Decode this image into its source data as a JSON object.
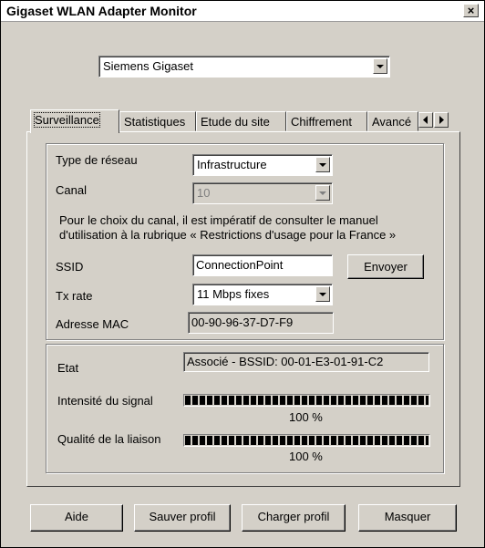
{
  "window": {
    "title": "Gigaset WLAN Adapter Monitor",
    "close_glyph": "×"
  },
  "adapter": {
    "selected": "Siemens Gigaset"
  },
  "tabs": [
    {
      "label": "Surveillance"
    },
    {
      "label": "Statistiques"
    },
    {
      "label": "Etude du site"
    },
    {
      "label": "Chiffrement"
    },
    {
      "label": "Avancé"
    }
  ],
  "config": {
    "network_type_label": "Type de réseau",
    "network_type_value": "Infrastructure",
    "channel_label": "Canal",
    "channel_value": "10",
    "notice_line1": "Pour le choix du canal, il est impératif de consulter le manuel",
    "notice_line2": "d'utilisation à la rubrique  « Restrictions d'usage pour la France »",
    "ssid_label": "SSID",
    "ssid_value": "ConnectionPoint",
    "send_button": "Envoyer",
    "txrate_label": "Tx rate",
    "txrate_value": "11 Mbps fixes",
    "mac_label": "Adresse MAC",
    "mac_value": "00-90-96-37-D7-F9"
  },
  "status": {
    "state_label": "Etat",
    "state_value": "Associé - BSSID: 00-01-E3-01-91-C2",
    "signal_label": "Intensité du signal",
    "signal_percent": 100,
    "signal_text": "100 %",
    "link_label": "Qualité de la liaison",
    "link_percent": 100,
    "link_text": "100 %"
  },
  "buttons": {
    "help": "Aide",
    "save_profile": "Sauver profil",
    "load_profile": "Charger profil",
    "hide": "Masquer"
  }
}
